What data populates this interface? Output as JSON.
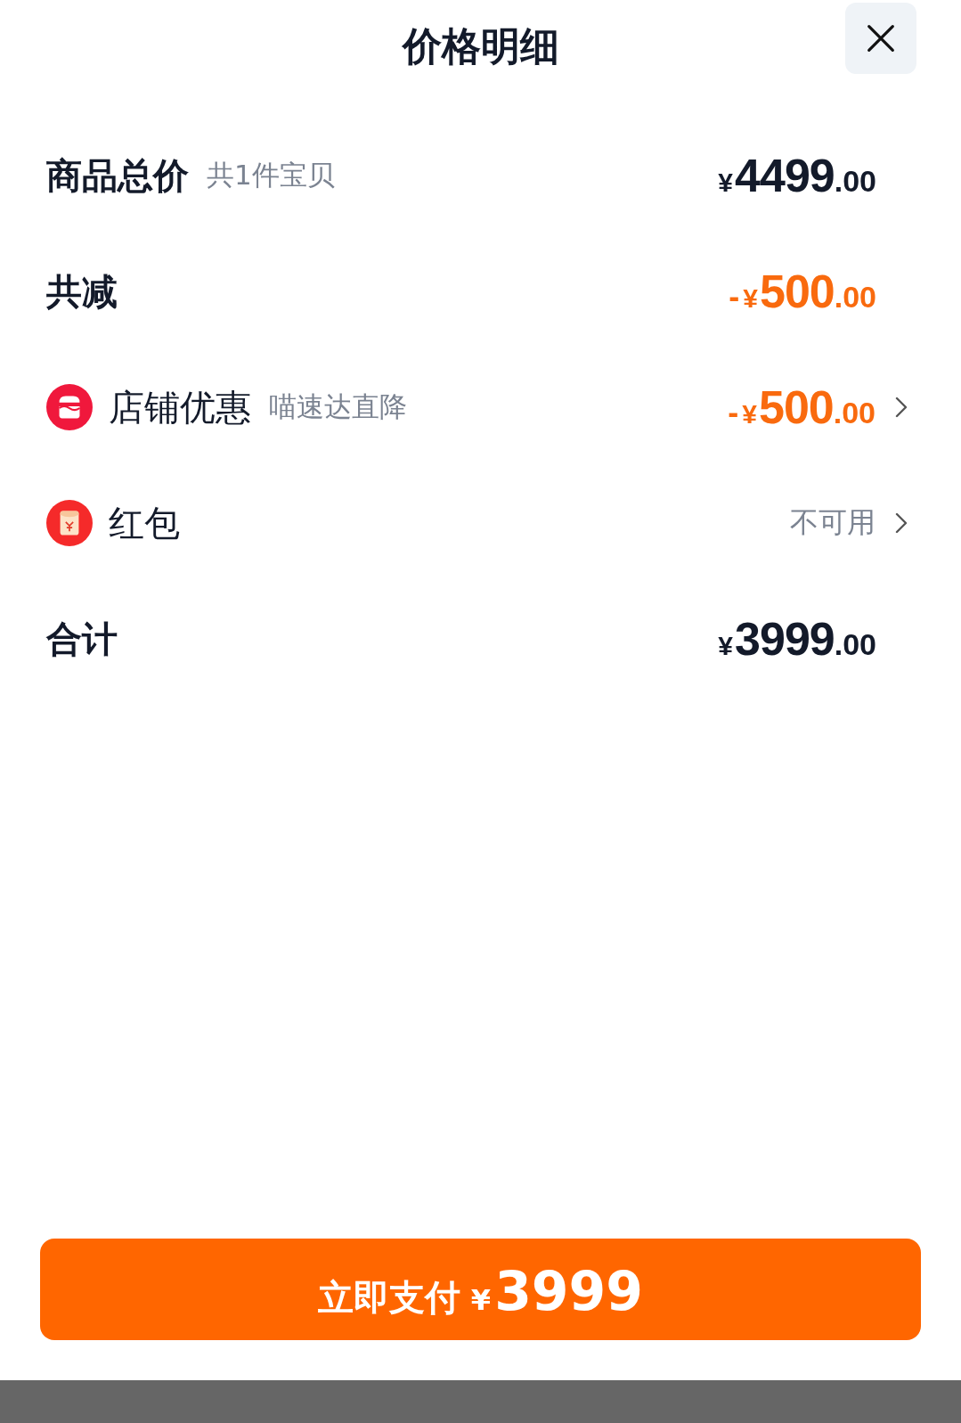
{
  "header": {
    "title": "价格明细"
  },
  "rows": [
    {
      "kind": "total",
      "label": "商品总价",
      "note": "共1件宝贝",
      "amount": {
        "currency": "¥",
        "whole": "4499",
        "fraction": ".00",
        "discount": false
      },
      "chevron": false
    },
    {
      "kind": "total",
      "label": "共减",
      "amount": {
        "sign": "-",
        "currency": "¥",
        "whole": "500",
        "fraction": ".00",
        "discount": true
      },
      "chevron": false
    },
    {
      "kind": "shop",
      "label": "店铺优惠",
      "note": "喵速达直降",
      "amount": {
        "sign": "-",
        "currency": "¥",
        "whole": "500",
        "fraction": ".00",
        "discount": true
      },
      "chevron": true
    },
    {
      "kind": "packet",
      "label": "红包",
      "status": "不可用",
      "chevron": true
    },
    {
      "kind": "total",
      "label": "合计",
      "amount": {
        "currency": "¥",
        "whole": "3999",
        "fraction": ".00",
        "discount": false
      },
      "chevron": false
    }
  ],
  "pay_button": {
    "label": "立即支付",
    "currency": "¥",
    "amount": "3999"
  }
}
